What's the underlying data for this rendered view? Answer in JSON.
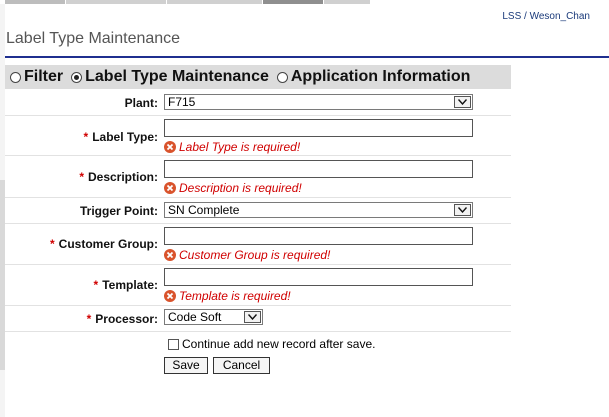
{
  "header": {
    "user_label": "LSS / Weson_Chan",
    "page_title": "Label Type Maintenance"
  },
  "modes": [
    {
      "label": "Filter",
      "selected": false
    },
    {
      "label": "Label Type Maintenance",
      "selected": true
    },
    {
      "label": "Application Information",
      "selected": false
    }
  ],
  "form": {
    "plant": {
      "label": "Plant:",
      "value": "F715"
    },
    "label_type": {
      "label": "Label Type:",
      "value": "",
      "error": "Label Type is required!"
    },
    "description": {
      "label": "Description:",
      "value": "",
      "error": "Description is required!"
    },
    "trigger_point": {
      "label": "Trigger Point:",
      "value": "SN Complete"
    },
    "customer_group": {
      "label": "Customer Group:",
      "value": "",
      "error": "Customer Group is required!"
    },
    "template": {
      "label": "Template:",
      "value": "",
      "error": "Template is required!"
    },
    "processor": {
      "label": "Processor:",
      "value": "Code Soft"
    },
    "required_mark": "*",
    "continue_label": "Continue add new record after save.",
    "continue_checked": false
  },
  "buttons": {
    "save": "Save",
    "cancel": "Cancel"
  },
  "colors": {
    "required": "#d00000",
    "title_rule": "#1f2f8f",
    "modebar": "#dcdcdc",
    "error_icon": "#d9532c"
  }
}
